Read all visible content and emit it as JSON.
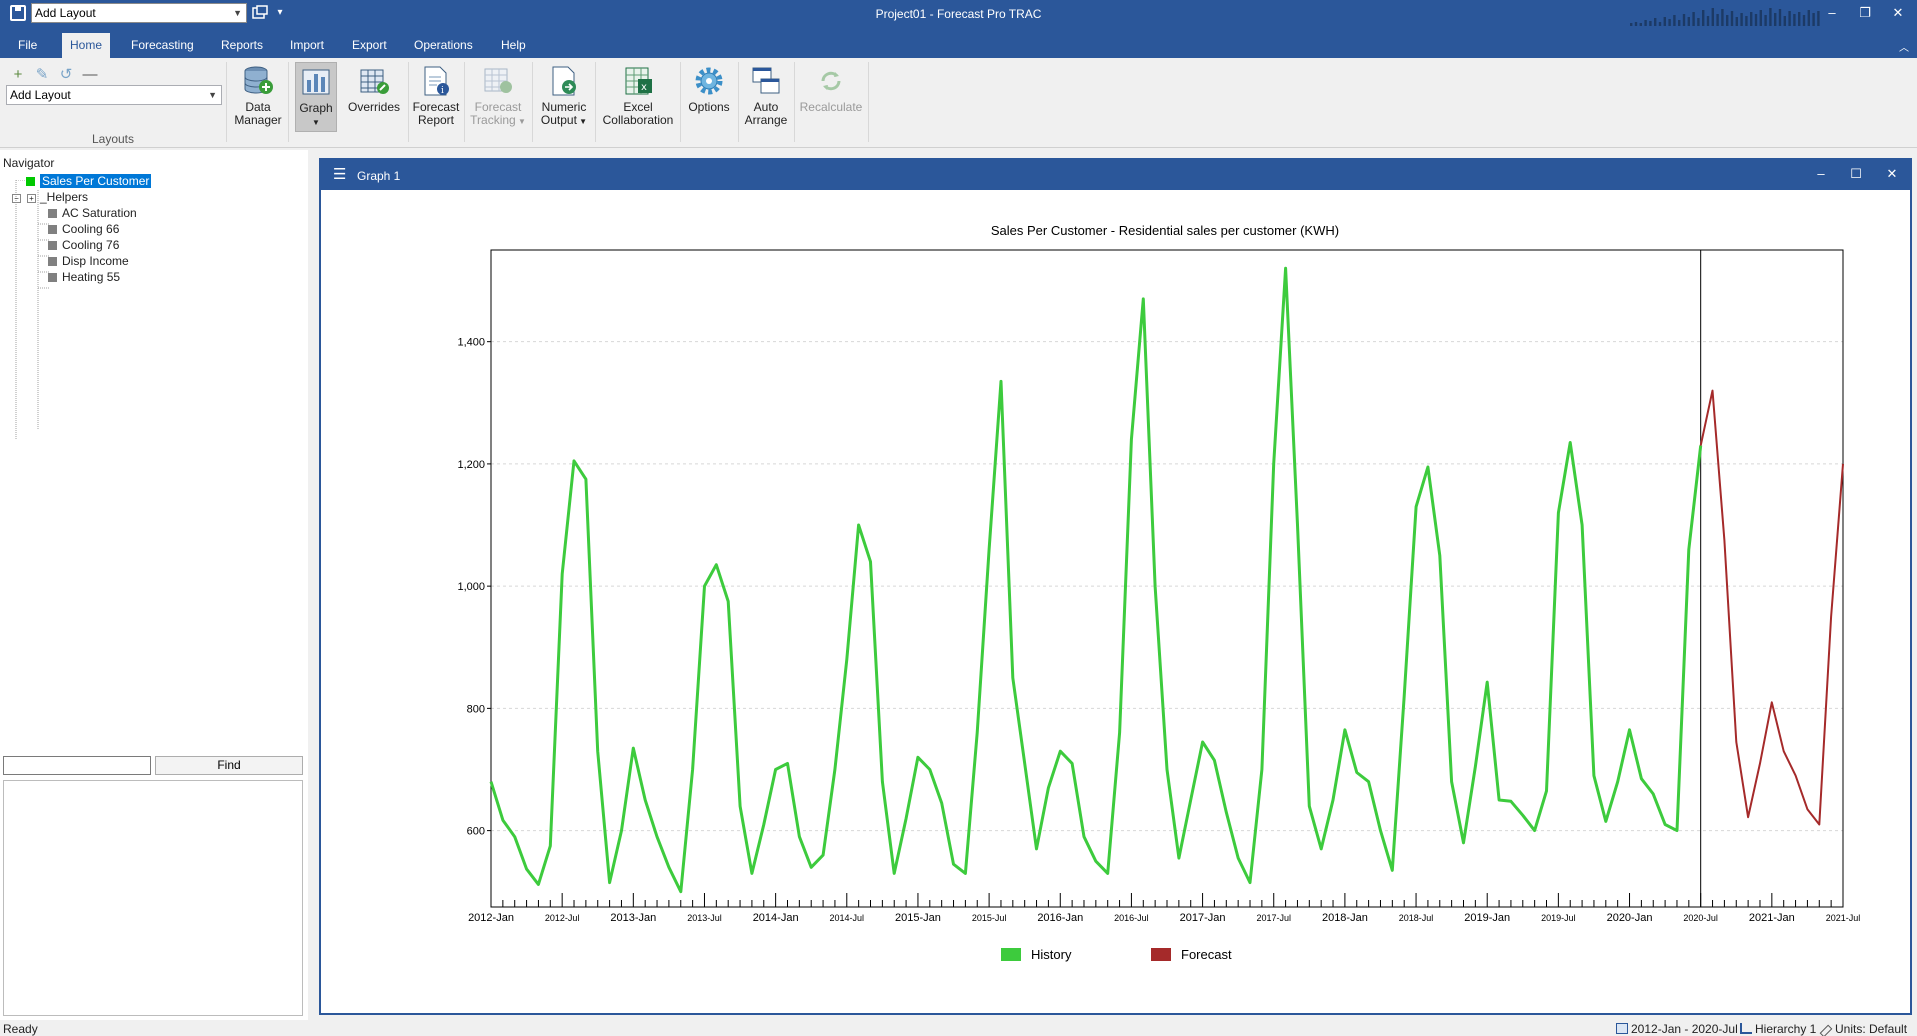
{
  "titlebar": {
    "layout_value": "Add Layout",
    "title": "Project01 - Forecast Pro TRAC"
  },
  "ribbon_tabs": [
    "File",
    "Home",
    "Forecasting",
    "Reports",
    "Import",
    "Export",
    "Operations",
    "Help"
  ],
  "ribbon": {
    "layout_value": "Add Layout",
    "group_label": "Layouts",
    "buttons": [
      {
        "line1": "Data",
        "line2": "Manager"
      },
      {
        "line1": "Graph",
        "line2": ""
      },
      {
        "line1": "Overrides",
        "line2": ""
      },
      {
        "line1": "Forecast",
        "line2": "Report"
      },
      {
        "line1": "Forecast",
        "line2": "Tracking"
      },
      {
        "line1": "Numeric",
        "line2": "Output"
      },
      {
        "line1": "Excel",
        "line2": "Collaboration"
      },
      {
        "line1": "Options",
        "line2": ""
      },
      {
        "line1": "Auto",
        "line2": "Arrange"
      },
      {
        "line1": "Recalculate",
        "line2": ""
      }
    ]
  },
  "navigator": {
    "title": "Navigator",
    "root": "Sales Per Customer",
    "helpers": "_Helpers",
    "items": [
      "AC Saturation",
      "Cooling 66",
      "Cooling 76",
      "Disp Income",
      "Heating 55"
    ],
    "find_label": "Find"
  },
  "graph_window": {
    "title": "Graph 1"
  },
  "colors": {
    "history": "#3dcb3d",
    "forecast": "#a52a2a",
    "accent": "#2b579a",
    "selection": "#0078d7"
  },
  "chart_data": {
    "type": "line",
    "title": "Sales Per Customer - Residential sales per customer (KWH)",
    "xlabel": "",
    "ylabel": "",
    "ylim": [
      475,
      1550
    ],
    "yticks": [
      600,
      800,
      1000,
      1200,
      1400
    ],
    "ytick_labels": [
      "600",
      "800",
      "1,000",
      "1,200",
      "1,400"
    ],
    "grid": true,
    "legend_position": "bottom-center",
    "xtick_labels": [
      "2012-Jan",
      "2012-Jul",
      "2013-Jan",
      "2013-Jul",
      "2014-Jan",
      "2014-Jul",
      "2015-Jan",
      "2015-Jul",
      "2016-Jan",
      "2016-Jul",
      "2017-Jan",
      "2017-Jul",
      "2018-Jan",
      "2018-Jul",
      "2019-Jan",
      "2019-Jul",
      "2020-Jan",
      "2020-Jul",
      "2021-Jan",
      "2021-Jul"
    ],
    "series": [
      {
        "name": "History",
        "start": "2012-Jan",
        "values": [
          680,
          617,
          590,
          537,
          512,
          575,
          1020,
          1205,
          1175,
          730,
          515,
          600,
          735,
          650,
          590,
          540,
          500,
          700,
          1000,
          1035,
          975,
          640,
          530,
          610,
          700,
          710,
          590,
          540,
          560,
          700,
          880,
          1100,
          1040,
          680,
          530,
          620,
          720,
          700,
          645,
          545,
          530,
          760,
          1060,
          1335,
          850,
          710,
          570,
          670,
          730,
          710,
          590,
          550,
          530,
          760,
          1240,
          1470,
          1000,
          700,
          555,
          650,
          745,
          715,
          630,
          555,
          515,
          700,
          1200,
          1520,
          1100,
          640,
          570,
          650,
          765,
          695,
          680,
          600,
          535,
          820,
          1130,
          1195,
          1050,
          680,
          580,
          705,
          843,
          650,
          648,
          625,
          600,
          665,
          1120,
          1235,
          1100,
          690,
          615,
          680,
          765,
          685,
          660,
          610,
          600,
          1060,
          1230
        ]
      },
      {
        "name": "Forecast",
        "start": "2020-Jul",
        "values": [
          1230,
          1320,
          1075,
          745,
          622,
          710,
          810,
          730,
          690,
          635,
          610,
          950,
          1200
        ]
      }
    ]
  },
  "statusbar": {
    "status": "Ready",
    "date_range": "2012-Jan - 2020-Jul",
    "hierarchy": "Hierarchy 1",
    "units": "Units: Default"
  }
}
